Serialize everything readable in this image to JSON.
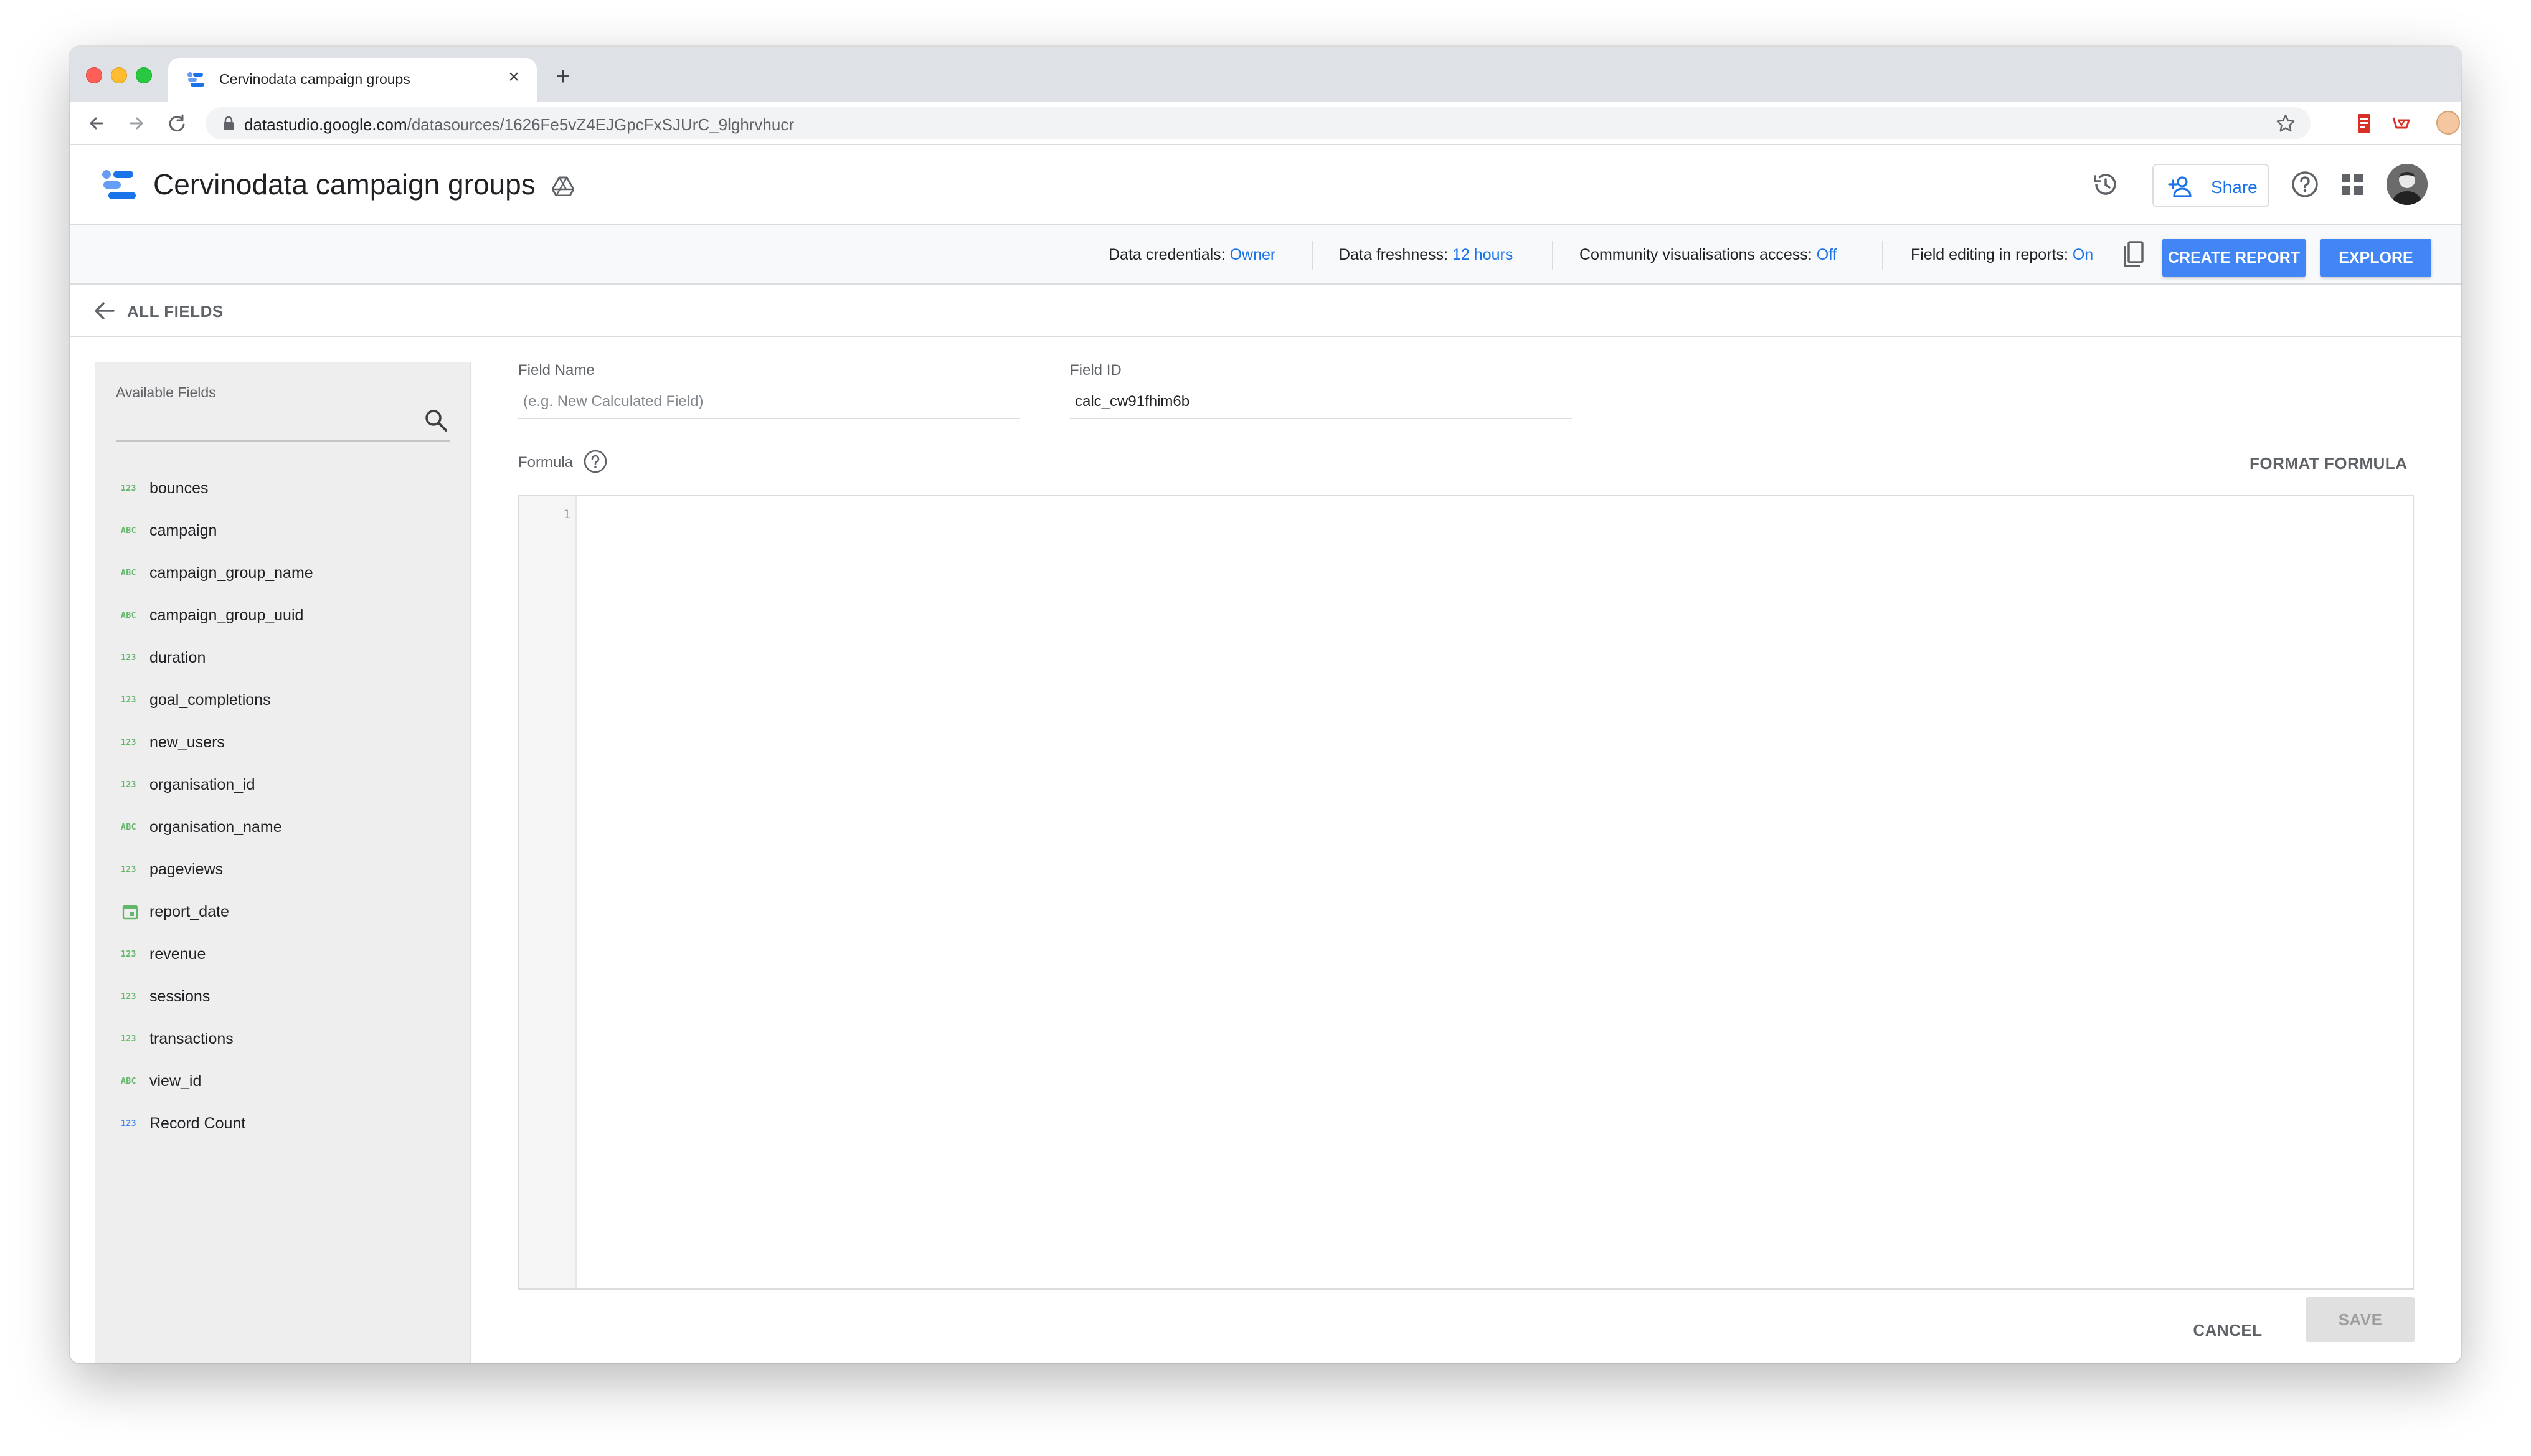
{
  "browser": {
    "tab_title": "Cervinodata campaign groups",
    "url_host": "datastudio.google.com",
    "url_path": "/datasources/1626Fe5vZ4EJGpcFxSJUrC_9lghrvhucr"
  },
  "header": {
    "title": "Cervinodata campaign groups",
    "share_label": "Share"
  },
  "infobar": {
    "credentials_label": "Data credentials:",
    "credentials_value": "Owner",
    "freshness_label": "Data freshness:",
    "freshness_value": "12 hours",
    "community_label": "Community visualisations access:",
    "community_value": "Off",
    "editing_label": "Field editing in reports:",
    "editing_value": "On",
    "create_report": "CREATE REPORT",
    "explore": "EXPLORE"
  },
  "nav": {
    "all_fields": "ALL FIELDS"
  },
  "sidebar": {
    "heading": "Available Fields",
    "fields": [
      {
        "type": "123",
        "name": "bounces"
      },
      {
        "type": "ABC",
        "name": "campaign"
      },
      {
        "type": "ABC",
        "name": "campaign_group_name"
      },
      {
        "type": "ABC",
        "name": "campaign_group_uuid"
      },
      {
        "type": "123",
        "name": "duration"
      },
      {
        "type": "123",
        "name": "goal_completions"
      },
      {
        "type": "123",
        "name": "new_users"
      },
      {
        "type": "123",
        "name": "organisation_id"
      },
      {
        "type": "ABC",
        "name": "organisation_name"
      },
      {
        "type": "123",
        "name": "pageviews"
      },
      {
        "type": "date",
        "name": "report_date"
      },
      {
        "type": "123",
        "name": "revenue"
      },
      {
        "type": "123",
        "name": "sessions"
      },
      {
        "type": "123",
        "name": "transactions"
      },
      {
        "type": "ABC",
        "name": "view_id"
      },
      {
        "type": "123",
        "name": "Record Count"
      }
    ]
  },
  "form": {
    "field_name_label": "Field Name",
    "field_name_placeholder": "(e.g. New Calculated Field)",
    "field_id_label": "Field ID",
    "field_id_value": "calc_cw91fhim6b",
    "formula_label": "Formula",
    "format_formula": "FORMAT FORMULA",
    "line_number": "1",
    "cancel": "CANCEL",
    "save": "SAVE"
  },
  "colors": {
    "accent_blue": "#4285f4",
    "link_blue": "#1a73e8",
    "field_type_green": "#63b76b"
  }
}
